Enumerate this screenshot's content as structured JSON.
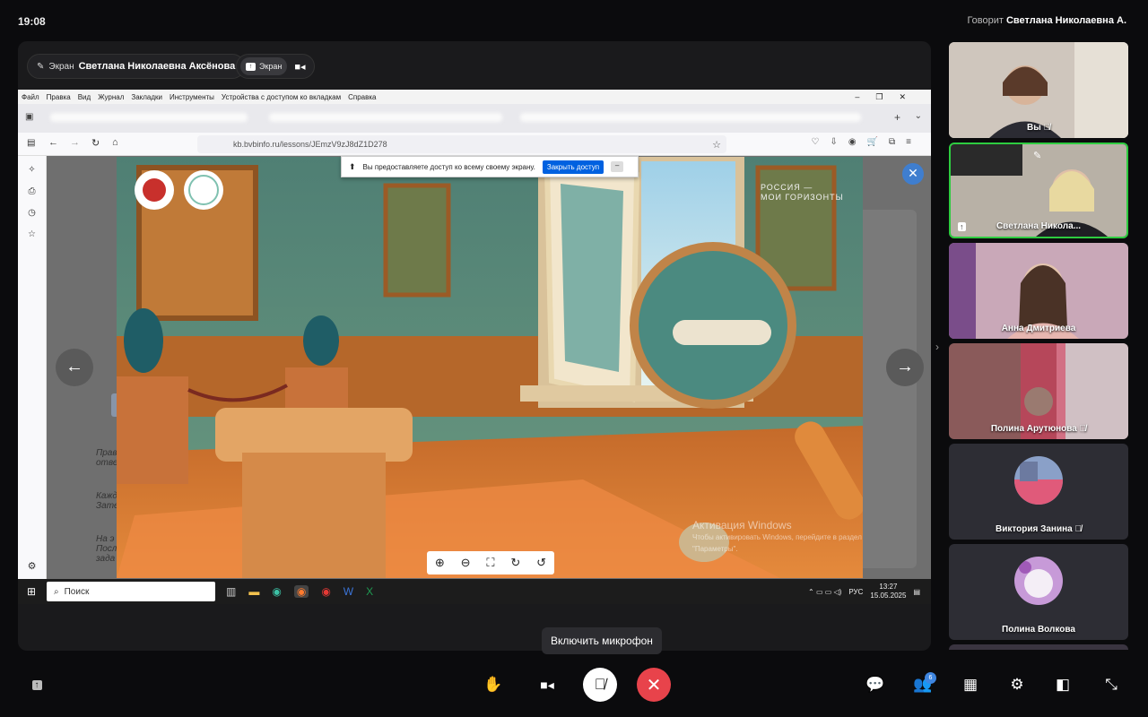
{
  "top": {
    "clock": "19:08",
    "speaking_prefix": "Говорит",
    "speaking_name": "Светлана Николаевна А."
  },
  "screen_chip": {
    "tag": "Экран",
    "name": "Светлана Николаевна Аксёнова"
  },
  "screen_toggle": {
    "label": "Экран"
  },
  "browser": {
    "menu": [
      "Файл",
      "Правка",
      "Вид",
      "Журнал",
      "Закладки",
      "Инструменты",
      "Устройства с доступом ко вкладкам",
      "Справка"
    ],
    "url": "kb.bvbinfo.ru/lessons/JEmzV9zJ8dZ1D278",
    "share_notice": "Вы предоставляете доступ ко всему своему экрану.",
    "share_button": "Закрыть доступ",
    "share_min": "–"
  },
  "lesson": {
    "brand_line1": "РОССИЯ —",
    "brand_line2": "МОИ ГОРИЗОНТЫ",
    "prev_icon": "arrow-left-icon",
    "next_icon": "arrow-right-icon"
  },
  "windows_watermark": {
    "title": "Активация Windows",
    "line1": "Чтобы активировать Windows, перейдите в раздел",
    "line2": "\"Параметры\"."
  },
  "taskbar": {
    "search": "Поиск",
    "lang": "РУС",
    "time": "13:27",
    "date": "15.05.2025"
  },
  "participants": [
    {
      "name": "Вы",
      "muted": true
    },
    {
      "name": "Светлана Никола...",
      "muted": false,
      "active": true
    },
    {
      "name": "Анна Дмитриева",
      "muted": false
    },
    {
      "name": "Полина Арутюнова",
      "muted": true
    },
    {
      "name": "Виктория Занина",
      "muted": true
    },
    {
      "name": "Полина Волкова",
      "muted": false
    }
  ],
  "controls": {
    "mic_tooltip": "Включить микрофон",
    "participants_badge": "6"
  },
  "colors": {
    "end_call": "#e8434b",
    "active_tile": "#2ecc40",
    "accent": "#3f86e0"
  }
}
